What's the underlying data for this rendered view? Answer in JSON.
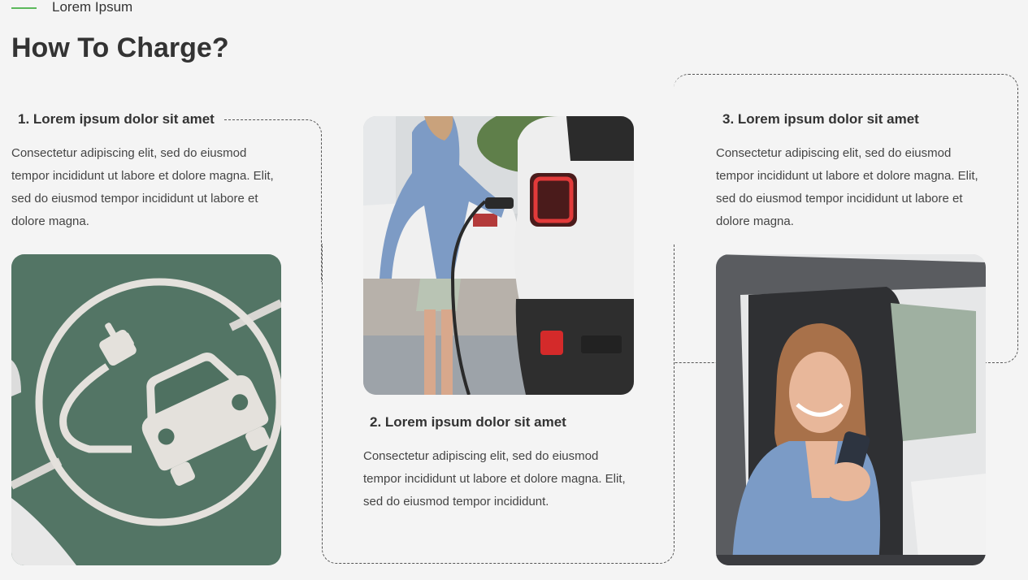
{
  "section": {
    "eyebrow": "Lorem Ipsum",
    "title": "How To Charge?"
  },
  "steps": [
    {
      "title": "1. Lorem ipsum dolor sit amet",
      "description": "Consectetur adipiscing elit, sed do eiusmod tempor incididunt ut labore et dolore magna. Elit, sed do eiusmod tempor incididunt ut labore et dolore magna.",
      "image": "ev-charging-parking-symbol"
    },
    {
      "title": "2. Lorem ipsum dolor sit amet",
      "description": "Consectetur adipiscing elit, sed do eiusmod tempor incididunt ut labore et dolore magna. Elit, sed do eiusmod tempor incididunt.",
      "image": "woman-plugging-charger-into-car"
    },
    {
      "title": "3. Lorem ipsum dolor sit amet",
      "description": "Consectetur adipiscing elit, sed do eiusmod tempor incididunt ut labore et dolore magna. Elit, sed do eiusmod tempor incididunt ut labore et dolore magna.",
      "image": "woman-in-car-using-phone"
    }
  ],
  "colors": {
    "background": "#f4f4f4",
    "accent_line": "#5cb85c",
    "text": "#333333"
  }
}
